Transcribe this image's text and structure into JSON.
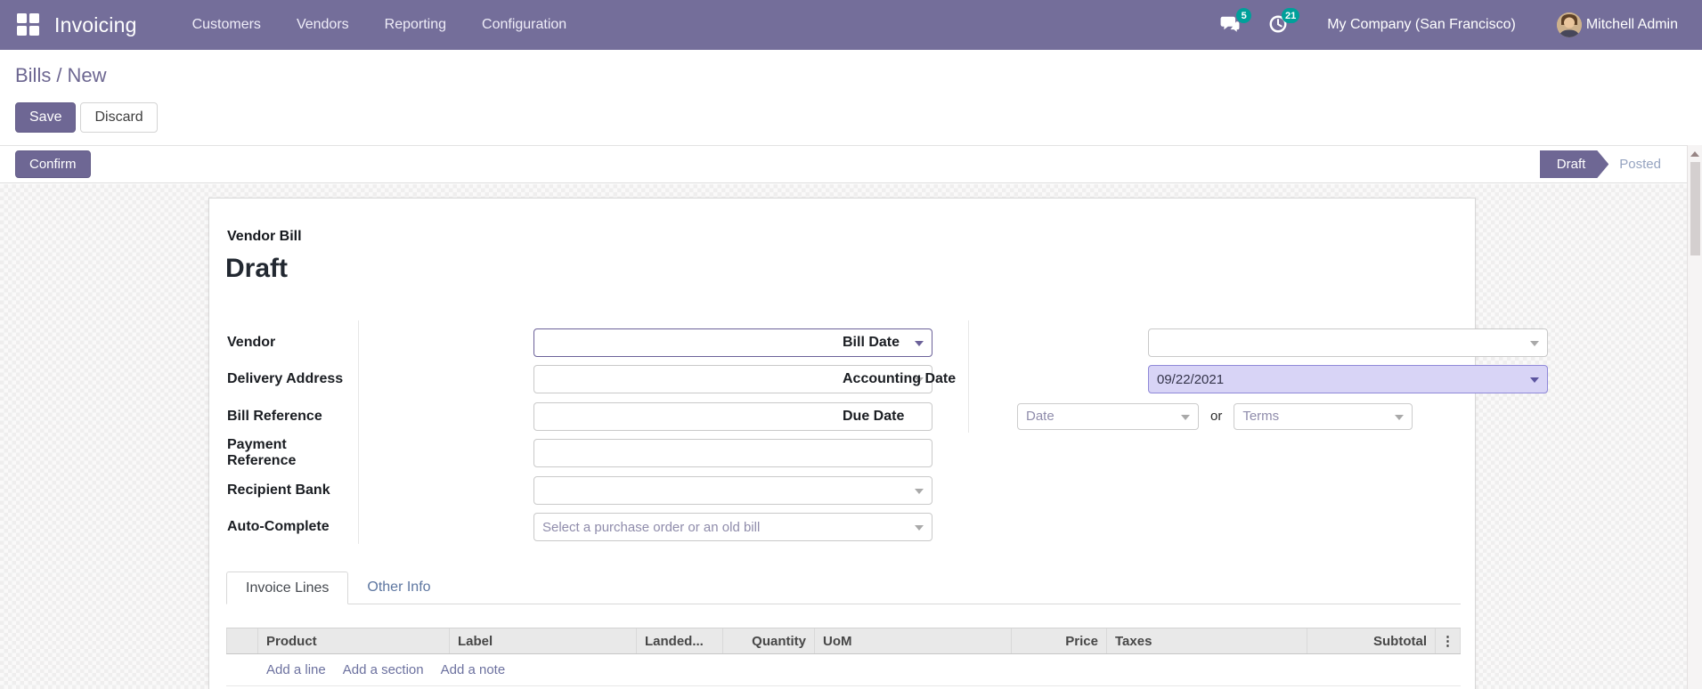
{
  "colors": {
    "navbar": "#746e9a",
    "primary": "#6e6794",
    "badge": "#00a09a",
    "accounting_bg": "#d8d4f6"
  },
  "navbar": {
    "app_name": "Invoicing",
    "menus": [
      "Customers",
      "Vendors",
      "Reporting",
      "Configuration"
    ],
    "badges": {
      "messages": "5",
      "activities": "21"
    },
    "company": "My Company (San Francisco)",
    "user": "Mitchell Admin"
  },
  "breadcrumb": {
    "parent": "Bills",
    "separator": "/",
    "current": "New"
  },
  "actions": {
    "save": "Save",
    "discard": "Discard",
    "confirm": "Confirm"
  },
  "statusbar": {
    "active_step": "Draft",
    "inactive_step": "Posted"
  },
  "doc": {
    "type_label": "Vendor Bill",
    "state_heading": "Draft"
  },
  "form": {
    "left_fields": [
      {
        "label": "Vendor"
      },
      {
        "label": "Delivery Address"
      },
      {
        "label": "Bill Reference"
      },
      {
        "label": "Payment Reference"
      },
      {
        "label": "Recipient Bank"
      },
      {
        "label": "Auto-Complete",
        "placeholder": "Select a purchase order or an old bill"
      }
    ],
    "right_fields": [
      {
        "label": "Bill Date"
      },
      {
        "label": "Accounting Date",
        "value": "09/22/2021"
      },
      {
        "label": "Due Date",
        "date_placeholder": "Date",
        "conjunction": "or",
        "terms_placeholder": "Terms"
      }
    ]
  },
  "tabs": [
    {
      "label": "Invoice Lines"
    },
    {
      "label": "Other Info"
    }
  ],
  "lines_table": {
    "columns": [
      "Product",
      "Label",
      "Landed...",
      "Quantity",
      "UoM",
      "Price",
      "Taxes",
      "Subtotal"
    ],
    "more_icon": "⋮",
    "links": [
      "Add a line",
      "Add a section",
      "Add a note"
    ]
  }
}
